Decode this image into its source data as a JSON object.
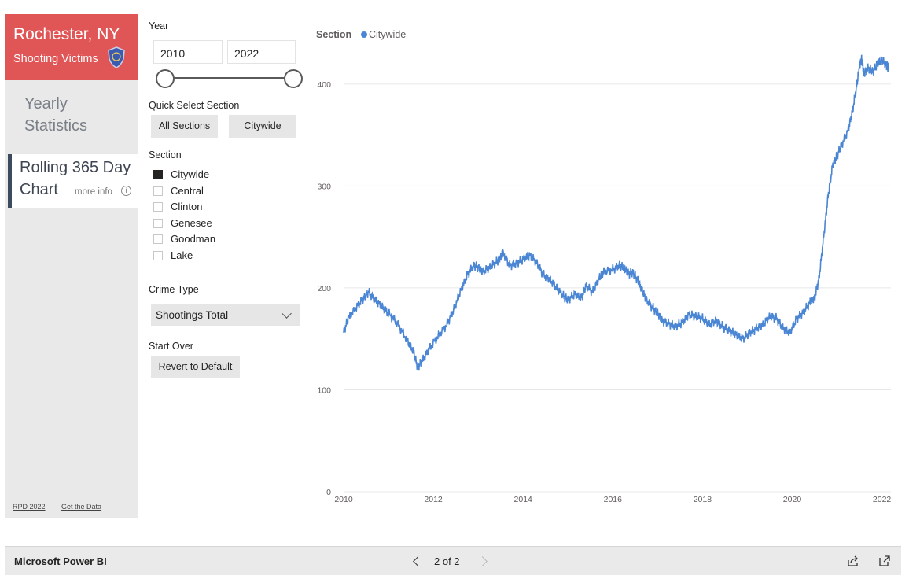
{
  "sidebar": {
    "city": "Rochester, NY",
    "subtitle": "Shooting Victims",
    "nav_yearly_line1": "Yearly",
    "nav_yearly_line2": "Statistics",
    "nav_rolling_line1": "Rolling 365 Day",
    "nav_rolling_line2": "Chart",
    "more_info": "more info",
    "info_glyph": "i",
    "footer_left": "RPD 2022",
    "footer_right": "Get the Data"
  },
  "filters": {
    "year_label": "Year",
    "year_start": "2010",
    "year_end": "2022",
    "quick_select_label": "Quick Select Section",
    "quick_all": "All Sections",
    "quick_citywide": "Citywide",
    "section_label": "Section",
    "sections": [
      {
        "name": "Citywide",
        "checked": true
      },
      {
        "name": "Central",
        "checked": false
      },
      {
        "name": "Clinton",
        "checked": false
      },
      {
        "name": "Genesee",
        "checked": false
      },
      {
        "name": "Goodman",
        "checked": false
      },
      {
        "name": "Lake",
        "checked": false
      }
    ],
    "crime_type_label": "Crime Type",
    "crime_type_value": "Shootings Total",
    "start_over_label": "Start Over",
    "revert_button": "Revert to Default"
  },
  "legend": {
    "title": "Section",
    "series": "Citywide"
  },
  "colors": {
    "series": "#4a86d3",
    "header": "#e05555",
    "accent_bar": "#3c4a5e"
  },
  "chart_data": {
    "type": "line",
    "ylim": [
      0,
      430
    ],
    "xlim": [
      2010,
      2022.2
    ],
    "yticks": [
      0,
      100,
      200,
      300,
      400
    ],
    "xticks": [
      2010,
      2012,
      2014,
      2016,
      2018,
      2020,
      2022
    ],
    "grid": true,
    "legend_position": "top-left",
    "series": [
      {
        "name": "Citywide",
        "points": [
          [
            2010.0,
            156
          ],
          [
            2010.1,
            170
          ],
          [
            2010.3,
            182
          ],
          [
            2010.45,
            190
          ],
          [
            2010.55,
            196
          ],
          [
            2010.7,
            188
          ],
          [
            2010.85,
            182
          ],
          [
            2011.0,
            175
          ],
          [
            2011.2,
            165
          ],
          [
            2011.4,
            150
          ],
          [
            2011.55,
            138
          ],
          [
            2011.65,
            122
          ],
          [
            2011.75,
            128
          ],
          [
            2011.9,
            140
          ],
          [
            2012.1,
            152
          ],
          [
            2012.3,
            164
          ],
          [
            2012.45,
            178
          ],
          [
            2012.6,
            196
          ],
          [
            2012.75,
            212
          ],
          [
            2012.9,
            222
          ],
          [
            2013.0,
            220
          ],
          [
            2013.1,
            216
          ],
          [
            2013.25,
            220
          ],
          [
            2013.4,
            225
          ],
          [
            2013.5,
            230
          ],
          [
            2013.55,
            234
          ],
          [
            2013.7,
            222
          ],
          [
            2013.85,
            224
          ],
          [
            2014.0,
            228
          ],
          [
            2014.15,
            232
          ],
          [
            2014.3,
            225
          ],
          [
            2014.45,
            213
          ],
          [
            2014.6,
            208
          ],
          [
            2014.75,
            200
          ],
          [
            2014.9,
            192
          ],
          [
            2015.0,
            188
          ],
          [
            2015.15,
            194
          ],
          [
            2015.3,
            190
          ],
          [
            2015.4,
            202
          ],
          [
            2015.55,
            196
          ],
          [
            2015.7,
            210
          ],
          [
            2015.8,
            216
          ],
          [
            2016.0,
            218
          ],
          [
            2016.15,
            222
          ],
          [
            2016.25,
            220
          ],
          [
            2016.35,
            214
          ],
          [
            2016.45,
            215
          ],
          [
            2016.55,
            208
          ],
          [
            2016.65,
            198
          ],
          [
            2016.75,
            188
          ],
          [
            2016.9,
            180
          ],
          [
            2017.0,
            175
          ],
          [
            2017.1,
            168
          ],
          [
            2017.25,
            165
          ],
          [
            2017.4,
            162
          ],
          [
            2017.55,
            166
          ],
          [
            2017.7,
            174
          ],
          [
            2017.85,
            172
          ],
          [
            2018.0,
            170
          ],
          [
            2018.15,
            164
          ],
          [
            2018.3,
            168
          ],
          [
            2018.45,
            162
          ],
          [
            2018.6,
            158
          ],
          [
            2018.75,
            154
          ],
          [
            2018.9,
            150
          ],
          [
            2019.05,
            156
          ],
          [
            2019.2,
            160
          ],
          [
            2019.35,
            164
          ],
          [
            2019.5,
            172
          ],
          [
            2019.65,
            170
          ],
          [
            2019.8,
            160
          ],
          [
            2019.95,
            156
          ],
          [
            2020.1,
            170
          ],
          [
            2020.25,
            176
          ],
          [
            2020.4,
            186
          ],
          [
            2020.5,
            190
          ],
          [
            2020.6,
            210
          ],
          [
            2020.7,
            250
          ],
          [
            2020.8,
            290
          ],
          [
            2020.9,
            320
          ],
          [
            2021.0,
            330
          ],
          [
            2021.1,
            340
          ],
          [
            2021.25,
            355
          ],
          [
            2021.35,
            375
          ],
          [
            2021.45,
            402
          ],
          [
            2021.5,
            418
          ],
          [
            2021.55,
            425
          ],
          [
            2021.6,
            410
          ],
          [
            2021.7,
            416
          ],
          [
            2021.8,
            412
          ],
          [
            2021.9,
            420
          ],
          [
            2022.0,
            424
          ],
          [
            2022.1,
            418
          ],
          [
            2022.15,
            416
          ]
        ]
      }
    ]
  },
  "bottom": {
    "brand": "Microsoft Power BI",
    "pager": "2 of 2"
  }
}
